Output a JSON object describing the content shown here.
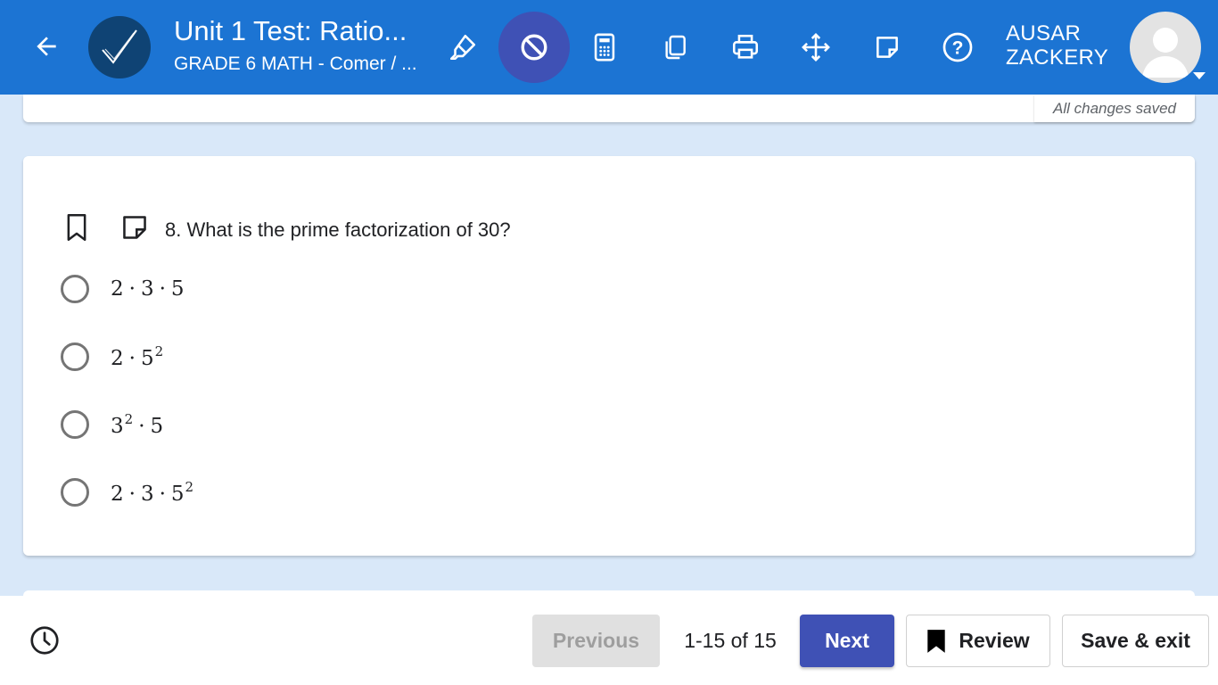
{
  "header": {
    "title": "Unit 1 Test: Ratio...",
    "subtitle": "GRADE 6 MATH - Comer / ...",
    "user_name_line1": "AUSAR",
    "user_name_line2": "ZACKERY",
    "tools": [
      "highlighter-icon",
      "answer-eliminator-icon",
      "calculator-icon",
      "copy-icon",
      "print-icon",
      "move-icon",
      "sticky-note-icon",
      "help-icon"
    ]
  },
  "status": {
    "saved_text": "All changes saved"
  },
  "question": {
    "text": "8. What is the prime factorization of 30?",
    "options": [
      {
        "parts": [
          "2",
          "3",
          "5"
        ],
        "exponent": ""
      },
      {
        "parts": [
          "2",
          "5"
        ],
        "exponent": "2"
      },
      {
        "parts": [
          "3",
          "5"
        ],
        "exponent_first": "2"
      },
      {
        "parts": [
          "2",
          "3",
          "5"
        ],
        "exponent": "2"
      }
    ]
  },
  "footer": {
    "previous_label": "Previous",
    "page_count": "1-15 of 15",
    "next_label": "Next",
    "review_label": "Review",
    "save_exit_label": "Save & exit"
  },
  "colors": {
    "header_bg": "#1c74d3",
    "accent": "#3f51b5",
    "page_bg": "#d9e8f9"
  }
}
